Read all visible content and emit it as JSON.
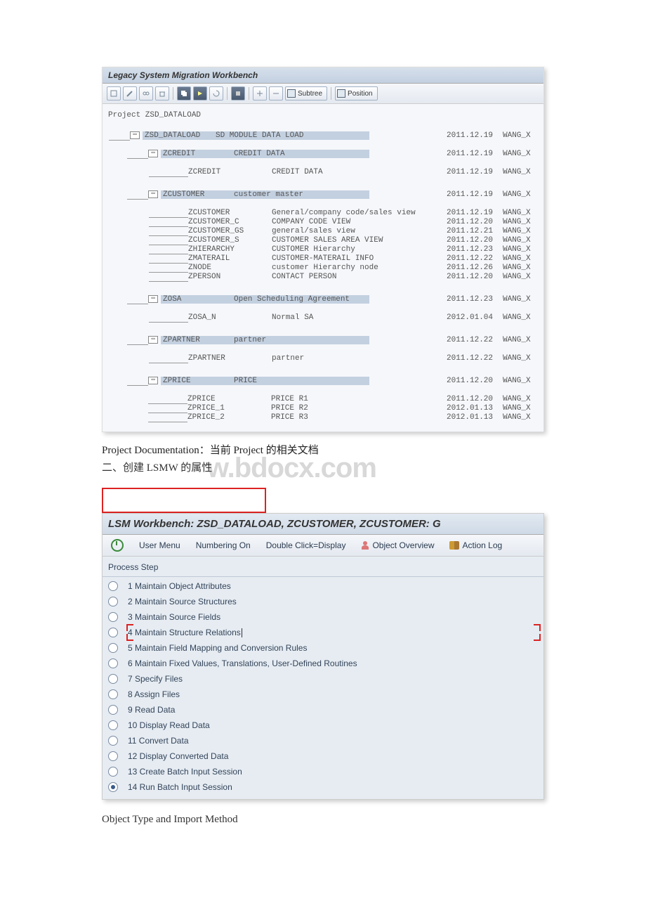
{
  "screen1": {
    "title": "Legacy System Migration Workbench",
    "toolbar": {
      "subtree": "Subtree",
      "position": "Position"
    },
    "project_label": "Project ZSD_DATALOAD",
    "root": {
      "name": "ZSD_DATALOAD",
      "desc": "SD MODULE DATA LOAD",
      "date": "2011.12.19",
      "user": "WANG_X"
    },
    "zcredit": {
      "name": "ZCREDIT",
      "desc": "CREDIT DATA",
      "date": "2011.12.19",
      "user": "WANG_X",
      "child": {
        "name": "ZCREDIT",
        "desc": "CREDIT DATA",
        "date": "2011.12.19",
        "user": "WANG_X"
      }
    },
    "zcustomer": {
      "name": "ZCUSTOMER",
      "desc": "customer master",
      "date": "2011.12.19",
      "user": "WANG_X",
      "children": [
        {
          "name": "ZCUSTOMER",
          "desc": "General/company code/sales view",
          "date": "2011.12.19",
          "user": "WANG_X"
        },
        {
          "name": "ZCUSTOMER_C",
          "desc": "COMPANY CODE VIEW",
          "date": "2011.12.20",
          "user": "WANG_X"
        },
        {
          "name": "ZCUSTOMER_GS",
          "desc": "general/sales view",
          "date": "2011.12.21",
          "user": "WANG_X"
        },
        {
          "name": "ZCUSTOMER_S",
          "desc": "CUSTOMER SALES AREA VIEW",
          "date": "2011.12.20",
          "user": "WANG_X"
        },
        {
          "name": "ZHIERARCHY",
          "desc": "CUSTOMER Hierarchy",
          "date": "2011.12.23",
          "user": "WANG_X"
        },
        {
          "name": "ZMATERAIL",
          "desc": "CUSTOMER-MATERAIL INFO",
          "date": "2011.12.22",
          "user": "WANG_X"
        },
        {
          "name": "ZNODE",
          "desc": "customer Hierarchy node",
          "date": "2011.12.26",
          "user": "WANG_X"
        },
        {
          "name": "ZPERSON",
          "desc": "CONTACT PERSON",
          "date": "2011.12.20",
          "user": "WANG_X"
        }
      ]
    },
    "zosa": {
      "name": "ZOSA",
      "desc": "Open Scheduling Agreement",
      "date": "2011.12.23",
      "user": "WANG_X",
      "child": {
        "name": "ZOSA_N",
        "desc": "Normal SA",
        "date": "2012.01.04",
        "user": "WANG_X"
      }
    },
    "zpartner": {
      "name": "ZPARTNER",
      "desc": "partner",
      "date": "2011.12.22",
      "user": "WANG_X",
      "child": {
        "name": "ZPARTNER",
        "desc": "partner",
        "date": "2011.12.22",
        "user": "WANG_X"
      }
    },
    "zprice": {
      "name": "ZPRICE",
      "desc": "PRICE",
      "date": "2011.12.20",
      "user": "WANG_X",
      "children": [
        {
          "name": "ZPRICE",
          "desc": "PRICE R1",
          "date": "2011.12.20",
          "user": "WANG_X"
        },
        {
          "name": "ZPRICE_1",
          "desc": "PRICE R2",
          "date": "2012.01.13",
          "user": "WANG_X"
        },
        {
          "name": "ZPRICE_2",
          "desc": "PRICE R3",
          "date": "2012.01.13",
          "user": "WANG_X"
        }
      ]
    }
  },
  "doc_line": "Project Documentation：当前 Project 的相关文档",
  "section2": "二、创建 LSMW 的属性",
  "watermark": "w.bdocx.com",
  "screen2": {
    "title": "LSM Workbench: ZSD_DATALOAD, ZCUSTOMER, ZCUSTOMER: G",
    "toolbar": {
      "user_menu": "User Menu",
      "numbering": "Numbering On",
      "dblclick": "Double Click=Display",
      "overview": "Object Overview",
      "actionlog": "Action Log"
    },
    "section": "Process Step",
    "steps": [
      "1 Maintain Object Attributes",
      "2 Maintain Source Structures",
      "3 Maintain Source Fields",
      "4 Maintain Structure Relations",
      "5 Maintain Field Mapping and Conversion Rules",
      "6 Maintain Fixed Values, Translations, User-Defined Routines",
      "7 Specify Files",
      "8 Assign Files",
      "9 Read Data",
      "10 Display Read Data",
      "11 Convert Data",
      "12 Display Converted Data",
      "13 Create Batch Input Session",
      "14 Run Batch Input Session"
    ],
    "selected": 13
  },
  "foot": "Object Type and Import Method"
}
